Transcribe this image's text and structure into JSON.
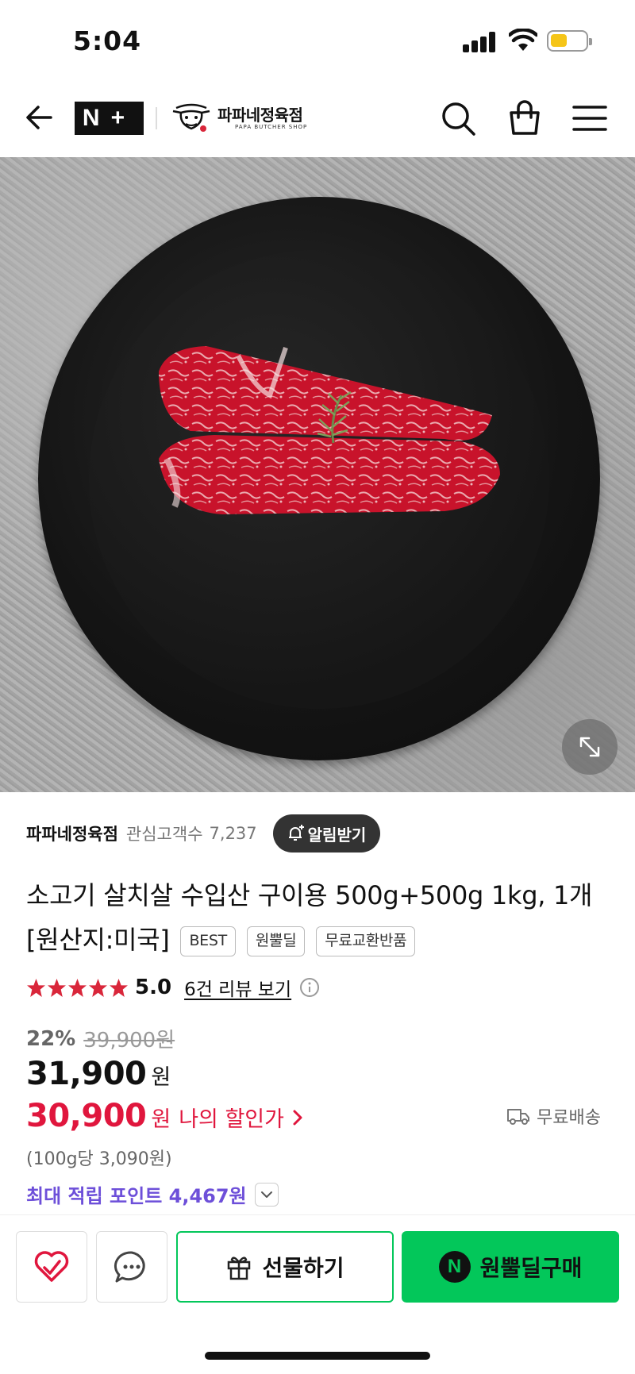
{
  "status": {
    "time": "5:04"
  },
  "header": {
    "brand_label": "N+",
    "shop_name": "파파네정육점",
    "shop_sub": "PAPA BUTCHER SHOP",
    "icons": [
      "back-arrow-icon",
      "search-icon",
      "cart-icon",
      "menu-icon"
    ]
  },
  "store": {
    "name": "파파네정육점",
    "follower_label": "관심고객수",
    "follower_count": "7,237",
    "alarm_label": "알림받기"
  },
  "product": {
    "title": "소고기 살치살 수입산 구이용 500g+500g 1kg, 1개 [원산지:미국]",
    "badges": [
      "BEST",
      "원뿔딜",
      "무료교환반품"
    ],
    "rating": "5.0",
    "stars": 5,
    "review_link": "6건 리뷰 보기",
    "discount_rate": "22%",
    "original_price": "39,900원",
    "price": "31,900",
    "currency": "원",
    "my_price": "30,900",
    "my_price_label": "나의 할인가",
    "shipping": "무료배송",
    "unit_price": "(100g당 3,090원)",
    "points": "최대 적립 포인트 4,467원"
  },
  "actions": {
    "gift_label": "선물하기",
    "buy_label": "원뿔딜구매"
  },
  "colors": {
    "accent_green": "#03c75a",
    "discount_red": "#e0163d",
    "points_purple": "#6d4fd9"
  }
}
